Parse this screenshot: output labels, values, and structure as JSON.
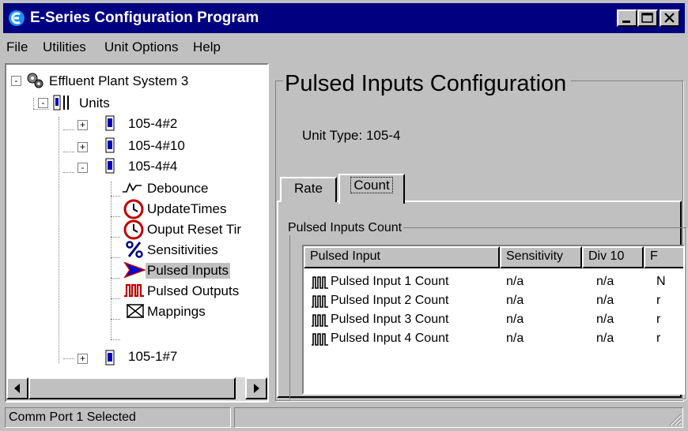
{
  "window": {
    "title": "E-Series Configuration Program",
    "icons": {
      "app": "e-series-app-icon",
      "minimize": "minimize-icon",
      "maximize": "maximize-icon",
      "close": "close-icon"
    },
    "colors": {
      "titlebar": "#000080",
      "face": "#c0c0c0",
      "selection": "#c0c0c0"
    }
  },
  "menu": [
    "File",
    "Utilities",
    "Unit Options",
    "Help"
  ],
  "tree": {
    "items": [
      {
        "label": "Effluent Plant System 3",
        "icon": "system-gears-icon",
        "toggle": "-"
      },
      {
        "label": "Units",
        "icon": "units-icon",
        "toggle": "-"
      },
      {
        "label": "105-4#2",
        "icon": "unit-icon",
        "toggle": "+"
      },
      {
        "label": "105-4#10",
        "icon": "unit-icon",
        "toggle": "+"
      },
      {
        "label": "105-4#4",
        "icon": "unit-icon",
        "toggle": "-"
      },
      {
        "label": "Debounce",
        "icon": "waveform-icon"
      },
      {
        "label": "UpdateTimes",
        "icon": "clock-icon"
      },
      {
        "label": "Ouput Reset Tir",
        "icon": "clock-icon"
      },
      {
        "label": "Sensitivities",
        "icon": "percent-icon"
      },
      {
        "label": "Pulsed Inputs",
        "icon": "arrow-icon",
        "selected": true
      },
      {
        "label": "Pulsed Outputs",
        "icon": "pulse-outputs-icon"
      },
      {
        "label": "Mappings",
        "icon": "mappings-icon"
      },
      {
        "label": "105-1#7",
        "icon": "unit-icon",
        "toggle": "+"
      }
    ]
  },
  "main": {
    "title": "Pulsed Inputs Configuration",
    "unit_type_label": "Unit Type:",
    "unit_type_value": "105-4",
    "tabs": [
      {
        "label": "Rate",
        "active": false
      },
      {
        "label": "Count",
        "active": true
      }
    ],
    "group_label": "Pulsed Inputs Count",
    "columns": [
      "Pulsed Input",
      "Sensitivity",
      "Div 10",
      "F"
    ],
    "rows": [
      {
        "name": "Pulsed Input 1 Count",
        "sensitivity": "n/a",
        "div10": "n/a",
        "extra": "N"
      },
      {
        "name": "Pulsed Input 2 Count",
        "sensitivity": "n/a",
        "div10": "n/a",
        "extra": "r"
      },
      {
        "name": "Pulsed Input 3 Count",
        "sensitivity": "n/a",
        "div10": "n/a",
        "extra": "r"
      },
      {
        "name": "Pulsed Input 4 Count",
        "sensitivity": "n/a",
        "div10": "n/a",
        "extra": "r"
      }
    ],
    "row_icon": "pulse-train-icon"
  },
  "status": {
    "text": "Comm Port 1 Selected",
    "extra": ""
  }
}
